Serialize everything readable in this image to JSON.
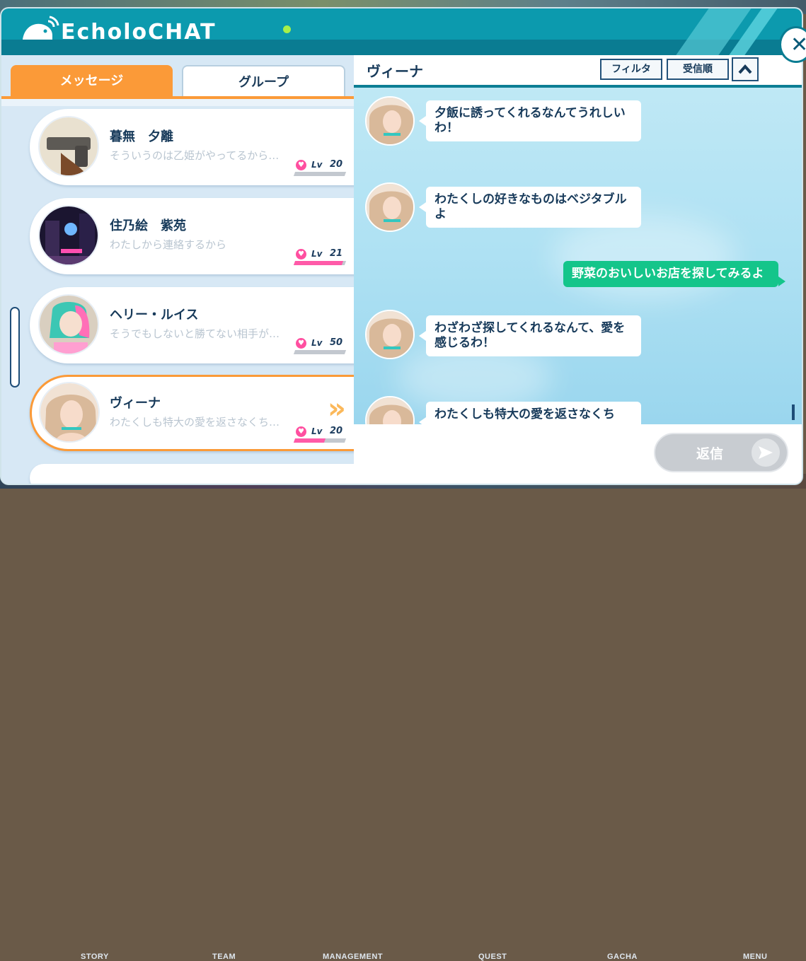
{
  "app": {
    "title": "EcholoCHAT"
  },
  "tabs": [
    {
      "label": "メッセージ",
      "active": true
    },
    {
      "label": "グループ",
      "active": false
    }
  ],
  "contacts": [
    {
      "name": "暮無　夕離",
      "preview": "そういうのは乙姫がやってるから…",
      "level_label": "Lv",
      "level": "20",
      "affection": 0.0
    },
    {
      "name": "住乃絵　紫苑",
      "preview": "わたしから連絡するから",
      "level_label": "Lv",
      "level": "21",
      "affection": 0.95
    },
    {
      "name": "ヘリー・ルイス",
      "preview": "そうでもしないと勝てない相手が…",
      "level_label": "Lv",
      "level": "50",
      "affection": 0.0
    },
    {
      "name": "ヴィーナ",
      "preview": "わたくしも特大の愛を返さなくち…",
      "level_label": "Lv",
      "level": "20",
      "affection": 0.6,
      "selected": true
    }
  ],
  "chat": {
    "title": "ヴィーナ",
    "filter_label": "フィルタ",
    "sort_label": "受信順",
    "collapse_icon": "chevron-up-icon",
    "messages": [
      {
        "from": "other",
        "text": "夕飯に誘ってくれるなんてうれしいわ！"
      },
      {
        "from": "other",
        "text": "わたくしの好きなものはベジタブルよ"
      },
      {
        "from": "me",
        "text": "野菜のおいしいお店を探してみるよ"
      },
      {
        "from": "other",
        "text": "わざわざ探してくれるなんて、愛を感じるわ！"
      },
      {
        "from": "other",
        "text": "わたくしも特大の愛を返さなくち"
      }
    ],
    "reply_label": "返信"
  },
  "bottom_nav": [
    "STORY",
    "TEAM",
    "MANAGEMENT",
    "QUEST",
    "GACHA",
    "MENU"
  ],
  "colors": {
    "header": "#0c9aae",
    "active_tab": "#fb9a38",
    "my_bubble": "#14c58a",
    "affection_bar": "#ff5aa8"
  }
}
